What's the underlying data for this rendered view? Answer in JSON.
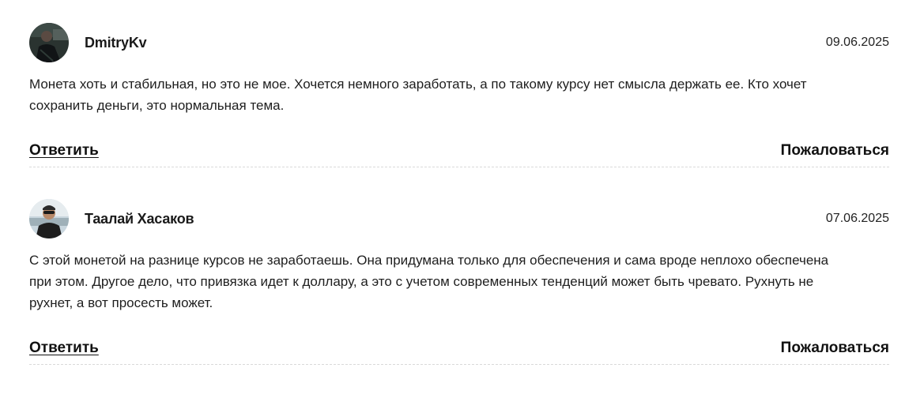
{
  "comments": [
    {
      "author": "DmitryKv",
      "date": "09.06.2025",
      "text": "Монета хоть и стабильная, но это не мое. Хочется немного заработать, а по такому курсу нет смысла держать ее. Кто хочет сохранить деньги, это нормальная тема.",
      "reply_label": "Ответить",
      "report_label": "Пожаловаться"
    },
    {
      "author": "Таалай Хасаков",
      "date": "07.06.2025",
      "text": "С этой монетой на разнице курсов не заработаешь. Она придумана только для обеспечения и сама вроде неплохо обеспечена при этом. Другое дело, что привязка идет к доллару, а это с учетом современных тенденций может быть чревато. Рухнуть не рухнет, а вот просесть может.",
      "reply_label": "Ответить",
      "report_label": "Пожаловаться"
    }
  ]
}
